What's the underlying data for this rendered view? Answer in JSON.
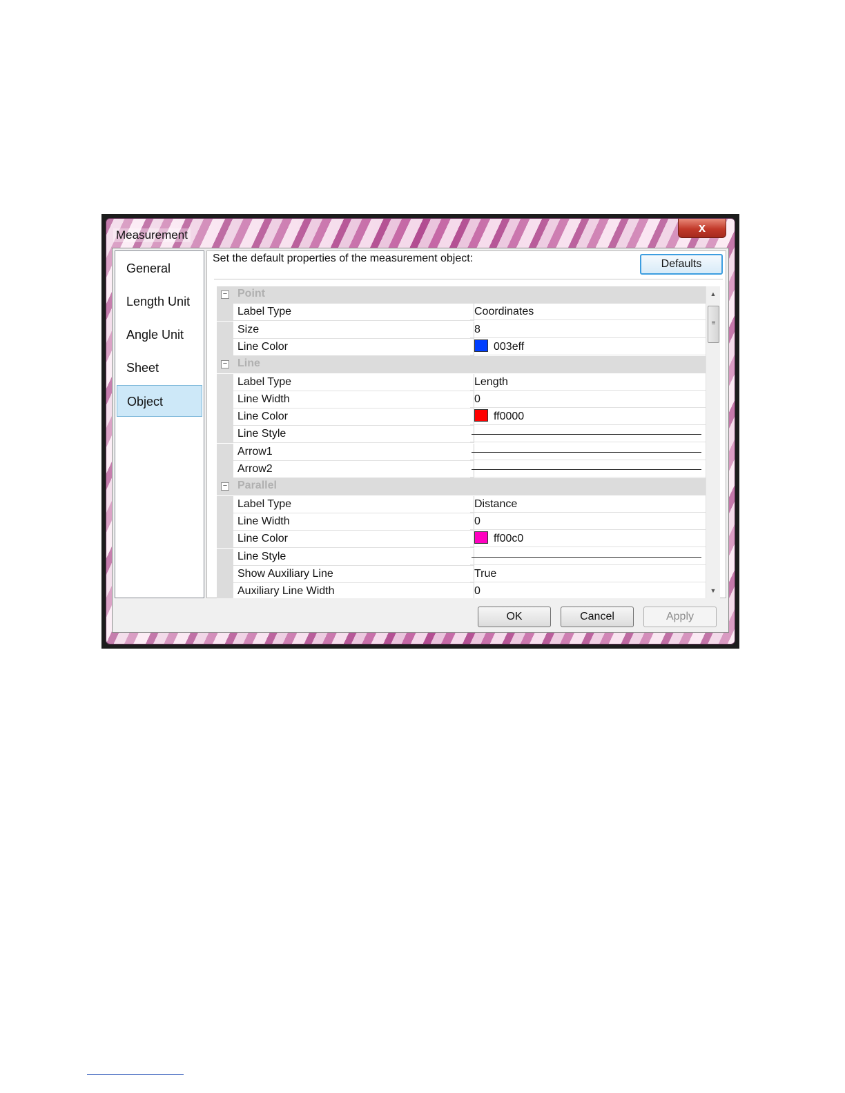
{
  "dialog": {
    "title": "Measurement",
    "close_label": "x",
    "description": "Set the default properties of the measurement object:",
    "defaults_label": "Defaults"
  },
  "nav": {
    "items": [
      {
        "label": "General",
        "selected": false
      },
      {
        "label": "Length Unit",
        "selected": false
      },
      {
        "label": "Angle Unit",
        "selected": false
      },
      {
        "label": "Sheet",
        "selected": false
      },
      {
        "label": "Object",
        "selected": true
      }
    ]
  },
  "grid": {
    "rows": [
      {
        "kind": "category",
        "name": "Point"
      },
      {
        "kind": "prop",
        "name": "Label Type",
        "value": "Coordinates"
      },
      {
        "kind": "prop",
        "name": "Size",
        "value": "8"
      },
      {
        "kind": "color",
        "name": "Line Color",
        "value": "003eff",
        "color": "#003eff"
      },
      {
        "kind": "category",
        "name": "Line"
      },
      {
        "kind": "prop",
        "name": "Label Type",
        "value": "Length"
      },
      {
        "kind": "prop",
        "name": "Line Width",
        "value": "0"
      },
      {
        "kind": "color",
        "name": "Line Color",
        "value": "ff0000",
        "color": "#ff0000"
      },
      {
        "kind": "line",
        "name": "Line Style"
      },
      {
        "kind": "line",
        "name": "Arrow1"
      },
      {
        "kind": "line",
        "name": "Arrow2"
      },
      {
        "kind": "category",
        "name": "Parallel"
      },
      {
        "kind": "prop",
        "name": "Label Type",
        "value": "Distance"
      },
      {
        "kind": "prop",
        "name": "Line Width",
        "value": "0"
      },
      {
        "kind": "color",
        "name": "Line Color",
        "value": "ff00c0",
        "color": "#ff00c0"
      },
      {
        "kind": "line",
        "name": "Line Style"
      },
      {
        "kind": "prop",
        "name": "Show Auxiliary Line",
        "value": "True"
      },
      {
        "kind": "prop",
        "name": "Auxiliary Line Width",
        "value": "0"
      }
    ]
  },
  "buttons": {
    "ok": "OK",
    "cancel": "Cancel",
    "apply": "Apply"
  },
  "scrollbar": {
    "up": "▲",
    "down": "▼",
    "grip": "≡"
  }
}
